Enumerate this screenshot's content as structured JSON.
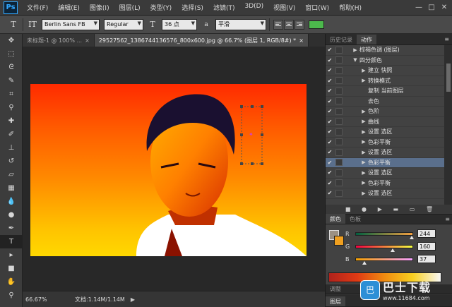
{
  "app": {
    "logo": "Ps"
  },
  "menu": [
    "文件(F)",
    "编辑(E)",
    "图像(I)",
    "图层(L)",
    "类型(Y)",
    "选择(S)",
    "滤镜(T)",
    "3D(D)",
    "视图(V)",
    "窗口(W)",
    "帮助(H)"
  ],
  "window_controls": {
    "minimize": "—",
    "restore": "□",
    "close": "✕"
  },
  "options_bar": {
    "tool_glyph": "T",
    "orient_glyph": "IT",
    "font_family": "Berlin Sans FB",
    "font_style": "Regular",
    "size_glyph": "T",
    "font_size": "36 点",
    "aa_glyph": "a",
    "antialias": "平滑",
    "text_color": "#4cb84c"
  },
  "tools": [
    {
      "name": "move-tool-icon",
      "glyph": "✥"
    },
    {
      "name": "marquee-tool-icon",
      "glyph": "⬚"
    },
    {
      "name": "lasso-tool-icon",
      "glyph": "ᘓ"
    },
    {
      "name": "quick-select-tool-icon",
      "glyph": "✎"
    },
    {
      "name": "crop-tool-icon",
      "glyph": "⌗"
    },
    {
      "name": "eyedropper-tool-icon",
      "glyph": "⚲"
    },
    {
      "name": "healing-brush-tool-icon",
      "glyph": "✚"
    },
    {
      "name": "brush-tool-icon",
      "glyph": "✐"
    },
    {
      "name": "clone-stamp-tool-icon",
      "glyph": "⊥"
    },
    {
      "name": "history-brush-tool-icon",
      "glyph": "↺"
    },
    {
      "name": "eraser-tool-icon",
      "glyph": "▱"
    },
    {
      "name": "gradient-tool-icon",
      "glyph": "▦"
    },
    {
      "name": "blur-tool-icon",
      "glyph": "💧"
    },
    {
      "name": "dodge-tool-icon",
      "glyph": "●"
    },
    {
      "name": "pen-tool-icon",
      "glyph": "✒"
    },
    {
      "name": "type-tool-icon",
      "glyph": "T"
    },
    {
      "name": "path-select-tool-icon",
      "glyph": "▸"
    },
    {
      "name": "shape-tool-icon",
      "glyph": "■"
    },
    {
      "name": "hand-tool-icon",
      "glyph": "✋"
    },
    {
      "name": "zoom-tool-icon",
      "glyph": "⚲"
    }
  ],
  "tabs": [
    {
      "label": "未标题-1 @ 100% ...",
      "close": "×"
    },
    {
      "label": "29527562_1386744136576_800x600.jpg @ 66.7% (图层 1, RGB/8#) *",
      "close": "×"
    }
  ],
  "status": {
    "zoom": "66.67%",
    "doc": "文档:1.14M/1.14M",
    "arrow": "▶"
  },
  "panels": {
    "top_tabs": [
      "历史记录",
      "动作"
    ],
    "actions": [
      {
        "check": "✔",
        "tri": "▶",
        "label": "棕褐色调 (图层)",
        "selected": false
      },
      {
        "check": "✔",
        "tri": "▼",
        "label": "四分颜色",
        "selected": false
      },
      {
        "check": "✔",
        "tri": "▶",
        "label": "建立 快照",
        "selected": false
      },
      {
        "check": "✔",
        "tri": "▶",
        "label": "转换模式",
        "selected": false
      },
      {
        "check": "✔",
        "tri": "",
        "label": "复制 当前图层",
        "selected": false
      },
      {
        "check": "✔",
        "tri": "",
        "label": "去色",
        "selected": false
      },
      {
        "check": "✔",
        "tri": "▶",
        "label": "色阶",
        "selected": false
      },
      {
        "check": "✔",
        "tri": "▶",
        "label": "曲线",
        "selected": false
      },
      {
        "check": "✔",
        "tri": "▶",
        "label": "设置 选区",
        "selected": false
      },
      {
        "check": "✔",
        "tri": "▶",
        "label": "色彩平衡",
        "selected": false
      },
      {
        "check": "✔",
        "tri": "▶",
        "label": "设置 选区",
        "selected": false
      },
      {
        "check": "✔",
        "tri": "▶",
        "label": "色彩平衡",
        "selected": true
      },
      {
        "check": "✔",
        "tri": "▶",
        "label": "设置 选区",
        "selected": false
      },
      {
        "check": "✔",
        "tri": "▶",
        "label": "色彩平衡",
        "selected": false
      },
      {
        "check": "✔",
        "tri": "▶",
        "label": "设置 选区",
        "selected": false
      }
    ],
    "actions_buttons": [
      "■",
      "●",
      "▶",
      "▬",
      "▭",
      "🗑"
    ],
    "color_tabs": [
      "颜色",
      "色板"
    ],
    "color": {
      "fg": "#9b9184",
      "bg": "#f0a020",
      "sliders": [
        {
          "label": "R",
          "value": "244",
          "level": 0.96,
          "gradient": "linear-gradient(90deg,#006040,#f4a040)"
        },
        {
          "label": "G",
          "value": "160",
          "level": 0.63,
          "gradient": "linear-gradient(90deg,#f40040,#f4ff40)"
        },
        {
          "label": "B",
          "value": "37",
          "level": 0.15,
          "gradient": "linear-gradient(90deg,#f4a000,#f4a0ff)"
        }
      ]
    },
    "adjust_tab": "调整",
    "layers_tab": "图层",
    "menu_glyph": "≡"
  },
  "watermark": {
    "icon": "巴",
    "title": "巴士下载",
    "url": "www.11684.com"
  }
}
